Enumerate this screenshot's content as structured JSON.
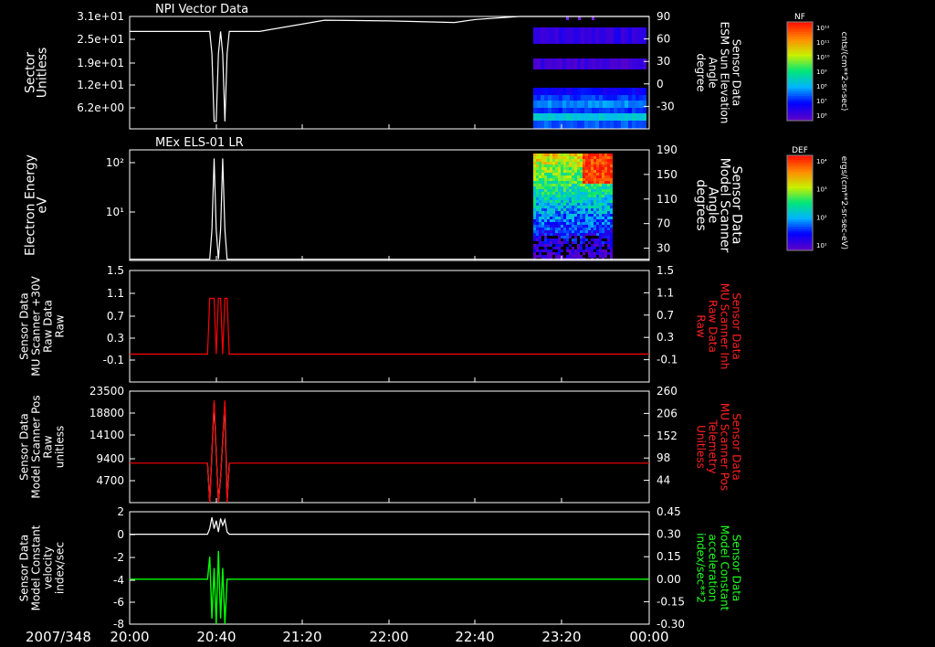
{
  "chart_data": {
    "type": "line",
    "date_label": "2007/348",
    "x_ticks": [
      "20:00",
      "20:40",
      "21:20",
      "22:00",
      "22:40",
      "23:20",
      "00:00"
    ],
    "panels": [
      {
        "id": "p1",
        "title": "NPI Vector Data",
        "left_label": [
          "Sector",
          "Unitless"
        ],
        "left_ticks": [
          "3.1e+01",
          "2.5e+01",
          "1.9e+01",
          "1.2e+01",
          "6.2e+00"
        ],
        "right_label": [
          "Sensor Data",
          "ESM Sun Elevation",
          "Angle",
          "degree"
        ],
        "right_ticks": [
          "90",
          "60",
          "30",
          "0",
          "-30"
        ],
        "right_range": [
          -60,
          90
        ],
        "line_color": "#ffffff",
        "series": {
          "x": [
            "20:00",
            "20:37",
            "20:38",
            "20:39",
            "20:40",
            "20:41",
            "20:42",
            "20:43",
            "20:44",
            "20:45",
            "20:46",
            "21:00",
            "21:30",
            "22:00",
            "22:30",
            "22:40",
            "23:00",
            "00:00"
          ],
          "y": [
            70,
            70,
            40,
            -50,
            -50,
            40,
            70,
            40,
            -50,
            40,
            70,
            70,
            85,
            84,
            82,
            86,
            90,
            90
          ]
        },
        "colorbar": {
          "label": "NF",
          "units": "cnts/(cm**2-sr-sec)",
          "ticks": [
            "10¹²",
            "10¹¹",
            "10¹⁰",
            "10⁹",
            "10⁸",
            "10⁷",
            "10⁶"
          ]
        }
      },
      {
        "id": "p2",
        "title": "MEx ELS-01 LR",
        "left_label": [
          "Electron Energy",
          "eV"
        ],
        "left_ticks": [
          "10²",
          "10¹"
        ],
        "right_label": [
          "Sensor Data",
          "Model Scanner",
          "Angle",
          "degrees"
        ],
        "right_ticks": [
          "190",
          "150",
          "110",
          "70",
          "30"
        ],
        "right_range": [
          10,
          190
        ],
        "line_color": "#ffffff",
        "series": {
          "x": [
            "20:00",
            "20:37",
            "20:38",
            "20:39",
            "20:40",
            "20:41",
            "20:42",
            "20:43",
            "20:44",
            "20:45",
            "20:46",
            "00:00"
          ],
          "y": [
            12,
            12,
            60,
            176,
            60,
            12,
            60,
            176,
            60,
            12,
            12,
            12
          ]
        },
        "colorbar": {
          "label": "DEF",
          "units": "ergs/(cm**2-sr-sec-eV)",
          "ticks": [
            "10⁴",
            "10³",
            "10²",
            "10¹"
          ]
        }
      },
      {
        "id": "p3",
        "title": "",
        "left_label": [
          "Sensor Data",
          "MU Scanner +30V",
          "Raw Data",
          "Raw"
        ],
        "left_ticks": [
          "1.5",
          "1.1",
          "0.7",
          "0.3",
          "-0.1"
        ],
        "right_label": [
          "Sensor Data",
          "MU Scanner Inh",
          "Raw Data",
          "Raw"
        ],
        "right_label_color": "#ff2020",
        "right_ticks": [
          "1.5",
          "1.1",
          "0.7",
          "0.3",
          "-0.1"
        ],
        "right_range": [
          -0.5,
          1.5
        ],
        "line_color": "#ff0000",
        "series": {
          "x": [
            "20:00",
            "20:36",
            "20:37",
            "20:38",
            "20:39",
            "20:40",
            "20:41",
            "20:42",
            "20:43",
            "20:44",
            "20:45",
            "20:46",
            "00:00"
          ],
          "y": [
            0,
            0,
            1,
            1,
            1,
            0,
            1,
            1,
            0,
            1,
            1,
            0,
            0
          ]
        }
      },
      {
        "id": "p4",
        "title": "",
        "left_label": [
          "Sensor Data",
          "Model Scanner Pos",
          "Raw",
          "unitless"
        ],
        "left_ticks": [
          "23500",
          "18800",
          "14100",
          "9400",
          "4700"
        ],
        "right_label": [
          "Sensor Data",
          "MU Scanner Pos",
          "Telemetry",
          "Unitless"
        ],
        "right_label_color": "#ff2020",
        "right_ticks": [
          "260",
          "206",
          "152",
          "98",
          "44"
        ],
        "right_range": [
          -10,
          260
        ],
        "line_color": "#ff0000",
        "series": {
          "x": [
            "20:00",
            "20:36",
            "20:37",
            "20:39",
            "20:41",
            "20:42",
            "20:44",
            "20:45",
            "20:46",
            "00:00"
          ],
          "y": [
            8000,
            8000,
            -500,
            21500,
            -500,
            5000,
            21500,
            -500,
            8000,
            8000
          ]
        },
        "series2": {
          "color": "#ffffff",
          "x": [
            "20:36",
            "20:37",
            "20:39",
            "20:41",
            "20:42",
            "20:44",
            "20:45",
            "20:46"
          ],
          "y": [
            8000,
            -500,
            21000,
            -500,
            5000,
            21000,
            -500,
            8000
          ]
        }
      },
      {
        "id": "p5",
        "title": "",
        "left_label": [
          "Sensor Data",
          "Model Constant",
          "velocity",
          "index/sec"
        ],
        "left_ticks": [
          "2",
          "0",
          "-2",
          "-4",
          "-6",
          "-8"
        ],
        "right_label": [
          "Sensor Data",
          "Model Constant",
          "acceleration",
          "index/sec**2"
        ],
        "right_label_color": "#20ff20",
        "right_ticks": [
          "0.45",
          "0.30",
          "0.15",
          "0.00",
          "-0.15",
          "-0.30"
        ],
        "right_range": [
          -0.3,
          0.45
        ],
        "line_color": "#ffffff",
        "series": {
          "x": [
            "20:00",
            "20:36",
            "20:37",
            "20:38",
            "20:39",
            "20:40",
            "20:41",
            "20:42",
            "20:43",
            "20:44",
            "20:45",
            "20:46",
            "00:00"
          ],
          "y": [
            0,
            0,
            0.5,
            1.5,
            0.5,
            1.2,
            0.2,
            1.4,
            0.8,
            1.3,
            0.2,
            0,
            0
          ]
        },
        "series2": {
          "color": "#00ff00",
          "x": [
            "20:00",
            "20:36",
            "20:37",
            "20:38",
            "20:39",
            "20:40",
            "20:41",
            "20:42",
            "20:43",
            "20:44",
            "20:45",
            "20:46",
            "00:00"
          ],
          "y": [
            -4,
            -4,
            -2,
            -7.5,
            -3,
            -8,
            -1.5,
            -7.5,
            -3,
            -8,
            -4,
            -4,
            -4
          ]
        }
      }
    ]
  }
}
